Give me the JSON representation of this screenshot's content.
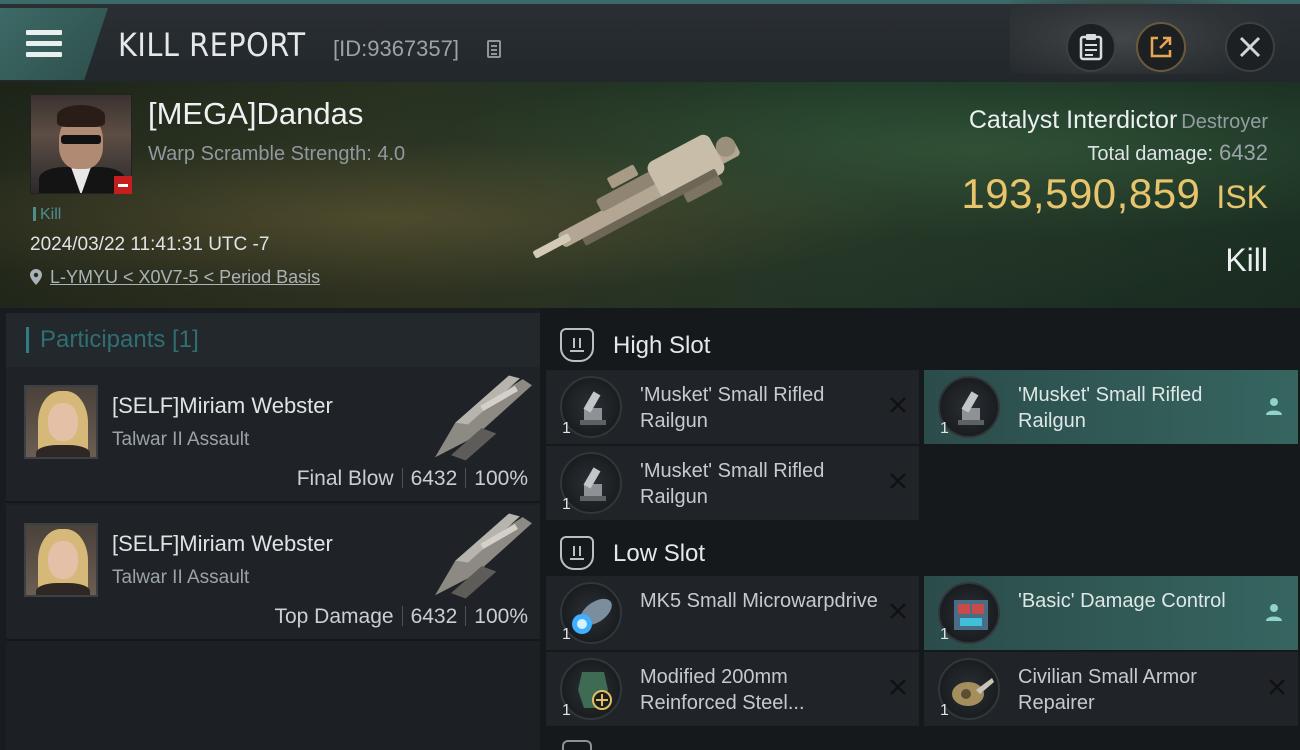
{
  "header": {
    "title": "KILL REPORT",
    "report_id": "[ID:9367357]"
  },
  "victim": {
    "name": "[MEGA]Dandas",
    "warp_scramble": "Warp Scramble Strength: 4.0",
    "tag": "Kill",
    "time": "2024/03/22 11:41:31 UTC -7",
    "location": "L-YMYU < X0V7-5 < Period Basis"
  },
  "ship": {
    "name": "Catalyst Interdictor",
    "class": "Destroyer",
    "total_damage_label": "Total damage:",
    "total_damage": "6432",
    "isk_value": "193,590,859",
    "isk_unit": "ISK",
    "result": "Kill"
  },
  "participants": {
    "header": "Participants [1]",
    "items": [
      {
        "name": "[SELF]Miriam Webster",
        "ship": "Talwar II Assault",
        "role": "Final Blow",
        "damage": "6432",
        "percent": "100%"
      },
      {
        "name": "[SELF]Miriam Webster",
        "ship": "Talwar II Assault",
        "role": "Top Damage",
        "damage": "6432",
        "percent": "100%"
      }
    ]
  },
  "fitting": {
    "high_slot": {
      "title": "High Slot",
      "modules": [
        {
          "name": "'Musket' Small Rifled Railgun",
          "qty": "1"
        },
        {
          "name": "'Musket' Small Rifled Railgun",
          "qty": "1"
        },
        {
          "name": "'Musket' Small Rifled Railgun",
          "qty": "1"
        }
      ]
    },
    "low_slot": {
      "title": "Low Slot",
      "modules": [
        {
          "name": "MK5 Small Microwarpdrive",
          "qty": "1"
        },
        {
          "name": "'Basic' Damage Control",
          "qty": "1"
        },
        {
          "name": "Modified 200mm Reinforced Steel...",
          "qty": "1"
        },
        {
          "name": "Civilian Small Armor Repairer",
          "qty": "1"
        }
      ]
    }
  },
  "colors": {
    "accent_teal": "#2f7f82",
    "isk_gold": "#e8c56d",
    "highlight_row": "#366560",
    "badge_red": "#c41e1e"
  },
  "icons": [
    "menu-icon",
    "copy-icon",
    "clipboard-icon",
    "share-icon",
    "close-icon",
    "map-pin-icon",
    "slot-icon",
    "remove-icon",
    "person-icon"
  ]
}
